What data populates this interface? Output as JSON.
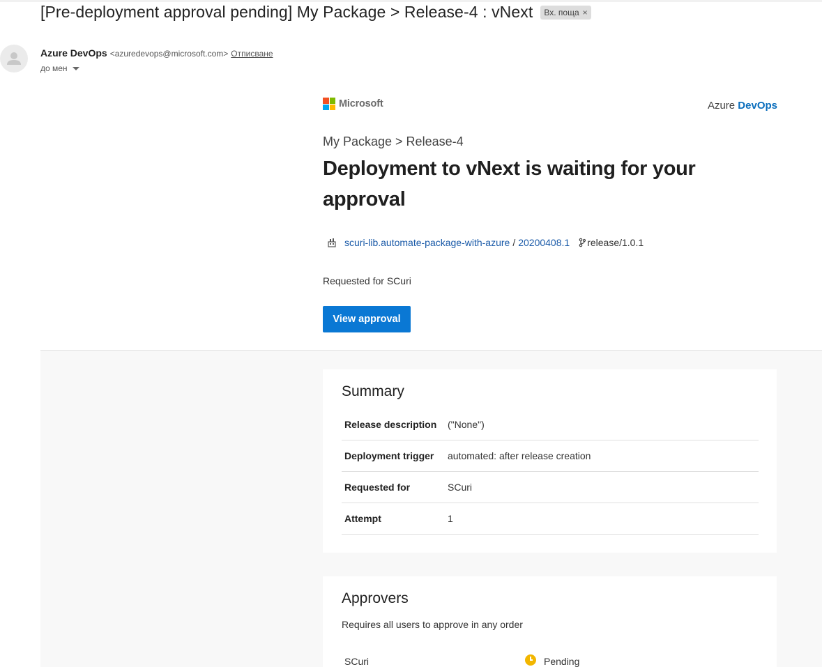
{
  "email": {
    "subject": "[Pre-deployment approval pending] My Package > Release-4 : vNext",
    "label": "Вх. поща",
    "label_close": "×",
    "sender_name": "Azure DevOps",
    "sender_email": "<azuredevops@microsoft.com>",
    "unsubscribe": "Отписване",
    "to": "до мен"
  },
  "brand": {
    "microsoft": "Microsoft",
    "azure_prefix": "Azure",
    "azure_devops": "DevOps",
    "ms_colors": [
      "#f25022",
      "#7fba00",
      "#00a4ef",
      "#ffb900"
    ]
  },
  "release": {
    "breadcrumb": "My Package > Release-4",
    "headline": "Deployment to vNext is waiting for your approval",
    "artifact": "scuri-lib.automate-package-with-azure",
    "separator": "/",
    "build_number": "20200408.1",
    "branch": "release/1.0.1",
    "requested_for": "Requested for SCuri",
    "view_button": "View approval"
  },
  "summary": {
    "title": "Summary",
    "rows": [
      {
        "key": "Release description",
        "value": "(\"None\")"
      },
      {
        "key": "Deployment trigger",
        "value": "automated: after release creation"
      },
      {
        "key": "Requested for",
        "value": "SCuri"
      },
      {
        "key": "Attempt",
        "value": "1"
      }
    ]
  },
  "approvers": {
    "title": "Approvers",
    "subtitle": "Requires all users to approve in any order",
    "items": [
      {
        "name": "SCuri",
        "status": "Pending"
      }
    ]
  },
  "colors": {
    "accent": "#0a78d4",
    "link": "#1a5aa8",
    "pending": "#f2b600"
  }
}
